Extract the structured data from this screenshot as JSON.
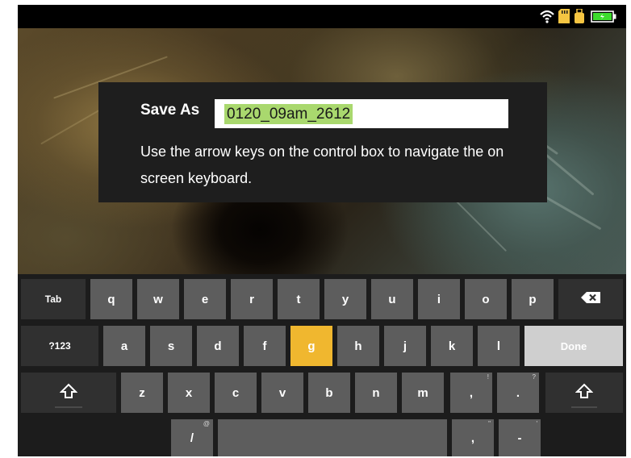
{
  "statusbar": {
    "icons": [
      "wifi-icon",
      "sd-card-icon",
      "usb-icon",
      "battery-charging-icon"
    ],
    "colors": {
      "wifi": "#ffffff",
      "sd_card": "#f5c542",
      "usb": "#f5c542",
      "battery": "#3ddc2e"
    }
  },
  "dialog": {
    "save_as_label": "Save As",
    "filename_value": "0120_09am_2612",
    "help_text": "Use the arrow keys on the control box to navigate the on screen keyboard."
  },
  "keyboard": {
    "tab": "Tab",
    "q": "q",
    "w": "w",
    "e": "e",
    "r": "r",
    "t": "t",
    "y": "y",
    "u": "u",
    "i": "i",
    "o": "o",
    "p": "p",
    "backspace_icon": "backspace-icon",
    "mode": "?123",
    "a": "a",
    "s": "s",
    "d": "d",
    "f": "f",
    "g": "g",
    "h": "h",
    "j": "j",
    "k": "k",
    "l": "l",
    "done": "Done",
    "shift_icon": "shift-icon",
    "z": "z",
    "x": "x",
    "c": "c",
    "v": "v",
    "b": "b",
    "n": "n",
    "m": "m",
    "comma": ",",
    "comma_alt": "!",
    "period": ".",
    "period_alt": "?",
    "slash": "/",
    "slash_alt": "@",
    "space": "",
    "comma2": ",",
    "comma2_alt": "\"",
    "dash": "-",
    "dash_alt": "'",
    "active_key": "g",
    "active_color": "#f0b72f"
  }
}
